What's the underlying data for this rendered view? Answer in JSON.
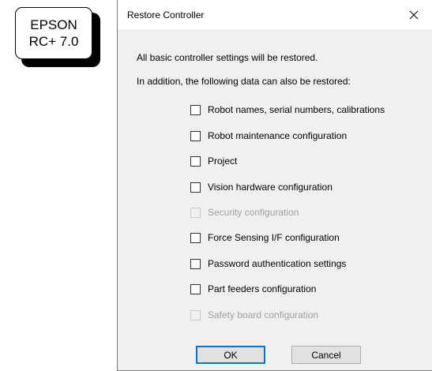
{
  "badge": {
    "line1": "EPSON",
    "line2": "RC+ 7.0"
  },
  "dialog": {
    "title": "Restore Controller",
    "intro_line1": "All basic controller settings will be restored.",
    "intro_line2": "In addition, the following data can also be restored:",
    "options": [
      {
        "label": "Robot names, serial numbers, calibrations",
        "checked": false,
        "enabled": true
      },
      {
        "label": "Robot maintenance configuration",
        "checked": false,
        "enabled": true
      },
      {
        "label": "Project",
        "checked": false,
        "enabled": true
      },
      {
        "label": "Vision hardware configuration",
        "checked": false,
        "enabled": true
      },
      {
        "label": "Security configuration",
        "checked": false,
        "enabled": false
      },
      {
        "label": "Force Sensing I/F configuration",
        "checked": false,
        "enabled": true
      },
      {
        "label": "Password authentication settings",
        "checked": false,
        "enabled": true
      },
      {
        "label": "Part feeders configuration",
        "checked": false,
        "enabled": true
      },
      {
        "label": "Safety board configuration",
        "checked": false,
        "enabled": false
      }
    ],
    "ok_label": "OK",
    "cancel_label": "Cancel",
    "accent_color": "#0078d7"
  }
}
